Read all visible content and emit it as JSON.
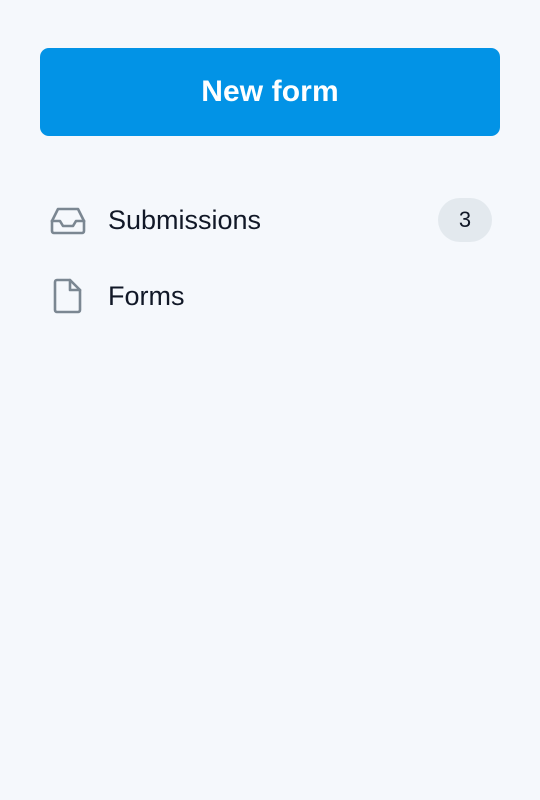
{
  "new_form_button": {
    "label": "New form",
    "color": "#0293e6"
  },
  "nav": {
    "items": [
      {
        "label": "Submissions",
        "icon": "inbox-icon",
        "badge": "3"
      },
      {
        "label": "Forms",
        "icon": "document-icon"
      }
    ]
  },
  "colors": {
    "background": "#f5f8fc",
    "icon": "#7b8792",
    "badge_background": "#e3e9ee",
    "text": "#111827"
  }
}
